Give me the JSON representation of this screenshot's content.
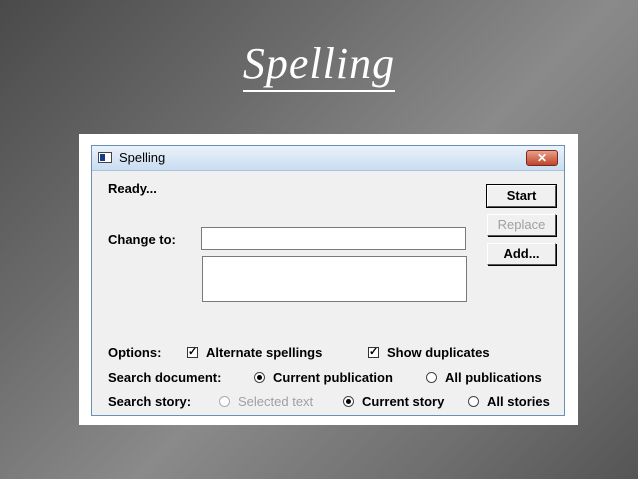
{
  "slide": {
    "title": "Spelling"
  },
  "dialog": {
    "title": "Spelling",
    "close_glyph": "✕",
    "status": "Ready...",
    "change_to_label": "Change to:",
    "change_to_value": "",
    "suggestions": [],
    "buttons": {
      "start": "Start",
      "replace": "Replace",
      "add": "Add..."
    },
    "options": {
      "label": "Options:",
      "alternate_spellings": {
        "label": "Alternate spellings",
        "checked": true
      },
      "show_duplicates": {
        "label": "Show duplicates",
        "checked": true
      }
    },
    "search_document": {
      "label": "Search document:",
      "current_publication": "Current publication",
      "all_publications": "All publications",
      "selected": "current_publication"
    },
    "search_story": {
      "label": "Search story:",
      "selected_text": "Selected text",
      "current_story": "Current story",
      "all_stories": "All stories",
      "selected": "current_story"
    }
  }
}
